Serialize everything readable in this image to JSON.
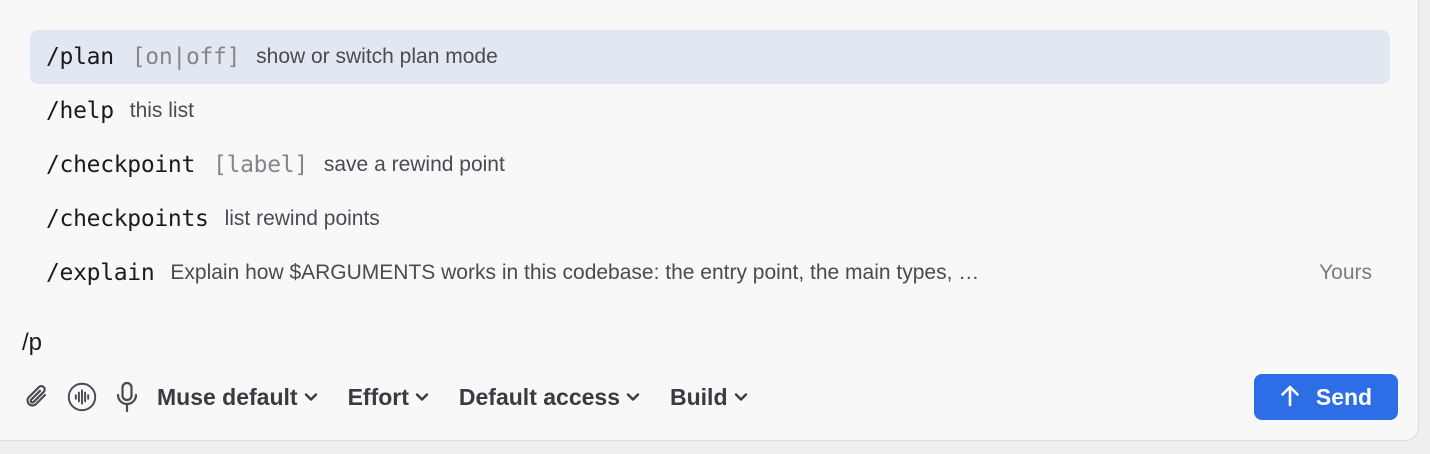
{
  "commands": [
    {
      "name": "/plan",
      "args": "[on|off]",
      "desc": "show or switch plan mode",
      "tag": ""
    },
    {
      "name": "/help",
      "args": "",
      "desc": "this list",
      "tag": ""
    },
    {
      "name": "/checkpoint",
      "args": "[label]",
      "desc": "save a rewind point",
      "tag": ""
    },
    {
      "name": "/checkpoints",
      "args": "",
      "desc": "list rewind points",
      "tag": ""
    },
    {
      "name": "/explain",
      "args": "",
      "desc": "Explain how $ARGUMENTS works in this codebase: the entry point, the main types, …",
      "tag": "Yours"
    }
  ],
  "input": {
    "value": "/p"
  },
  "toolbar": {
    "icons": [
      "paperclip-icon",
      "voice-waveform-icon",
      "microphone-icon"
    ],
    "model_label": "Muse default",
    "effort_label": "Effort",
    "access_label": "Default access",
    "mode_label": "Build",
    "send_label": "Send"
  },
  "colors": {
    "accent": "#2d6ee6",
    "selected_row": "#e2e8f2"
  }
}
